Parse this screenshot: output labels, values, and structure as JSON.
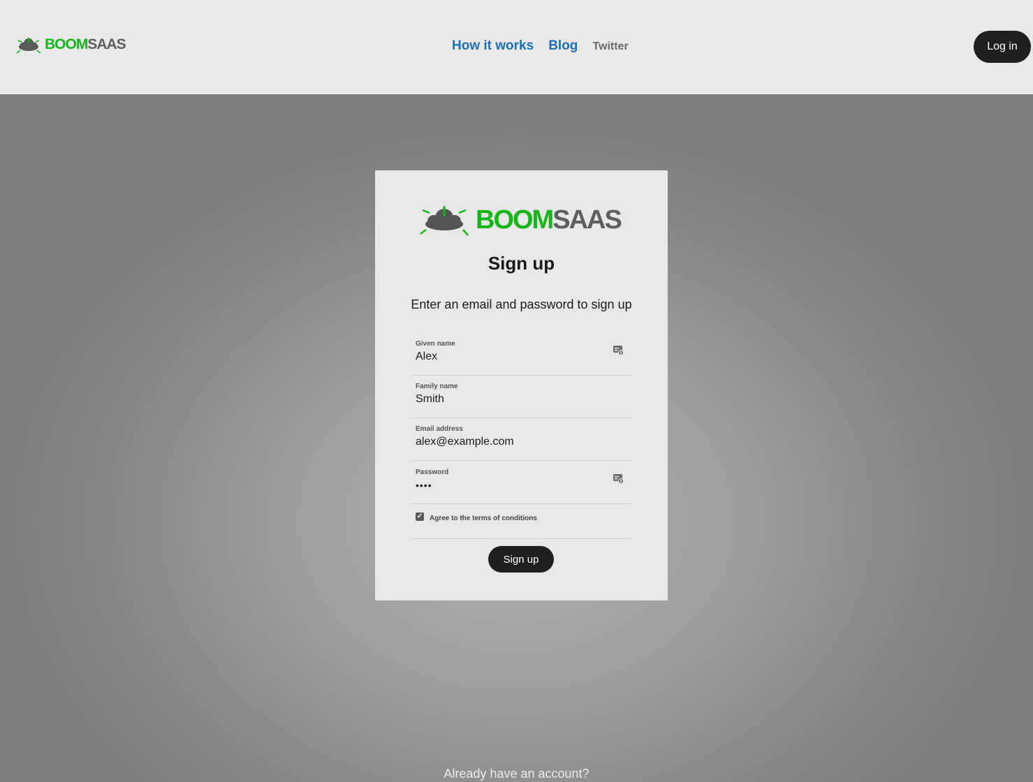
{
  "header": {
    "logo": {
      "word_green": "BOOM",
      "word_gray": "SAAS"
    },
    "nav": {
      "how_it_works": "How it works",
      "blog": "Blog",
      "twitter": "Twitter"
    },
    "login_label": "Log in"
  },
  "card": {
    "logo": {
      "word_green": "BOOM",
      "word_gray": "SAAS"
    },
    "title": "Sign up",
    "subtitle": "Enter an email and password to sign up",
    "fields": [
      {
        "label": "Given name",
        "value": "Alex"
      },
      {
        "label": "Family name",
        "value": "Smith"
      },
      {
        "label": "Email address",
        "value": "alex@example.com"
      },
      {
        "label": "Password",
        "value": "••••"
      }
    ],
    "terms": {
      "label": "Agree to the terms of conditions",
      "checked": true
    },
    "submit_label": "Sign up"
  },
  "footer": {
    "already_text": "Already have an account?"
  },
  "colors": {
    "brand_green": "#17b51a",
    "brand_gray": "#5f5f5f",
    "link_blue": "#1e6fb4",
    "button_dark": "#1f1f1f"
  },
  "icons": {
    "logo": "cloud-power-icon",
    "autofill": "contact-card-icon",
    "checkbox": "checkmark-icon"
  }
}
